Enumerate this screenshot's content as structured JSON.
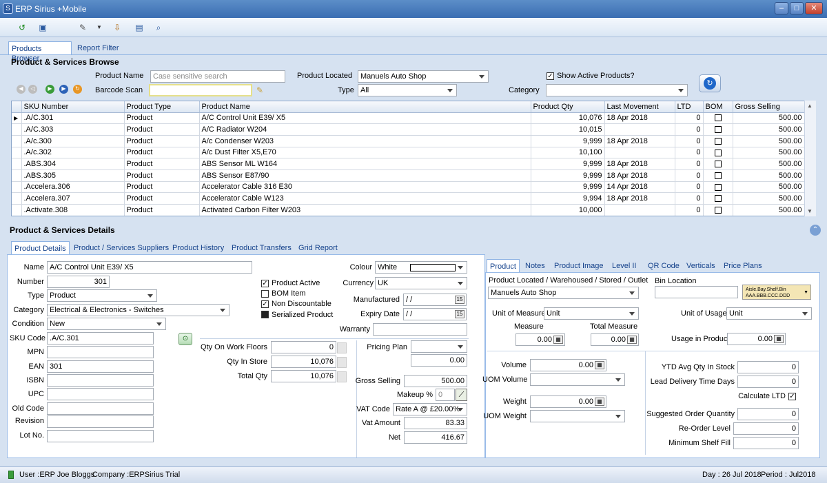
{
  "window": {
    "title": "ERP Sirius +Mobile",
    "icon": "app-icon"
  },
  "toolbar": {
    "icons": [
      "refresh-icon",
      "new-document-icon",
      "wrench-icon",
      "dropdown-icon",
      "export-icon",
      "save-icon",
      "search-icon"
    ]
  },
  "main_tabs": [
    "Products Browser",
    "Report Filter"
  ],
  "browse": {
    "title": "Product & Services Browse",
    "product_name_label": "Product Name",
    "product_name_placeholder": "Case sensitive search",
    "barcode_label": "Barcode Scan",
    "barcode_value": "",
    "located_label": "Product Located",
    "located_value": "Manuels Auto Shop",
    "type_label": "Type",
    "type_value": "All",
    "category_label": "Category",
    "category_value": "",
    "active_label": "Show Active Products?",
    "active_checked": true
  },
  "grid": {
    "columns": [
      "SKU Number",
      "Product Type",
      "Product Name",
      "Product Qty",
      "Last Movement",
      "LTD",
      "BOM",
      "Gross Selling"
    ],
    "rows": [
      [
        ".A/C.301",
        "Product",
        "A/C Control Unit E39/ X5",
        "10,076",
        "18 Apr 2018",
        "0",
        "",
        "500.00"
      ],
      [
        ".A/C.303",
        "Product",
        "A/C Radiator W204",
        "10,015",
        "",
        "0",
        "",
        "500.00"
      ],
      [
        ".A/c.300",
        "Product",
        "A/c Condenser W203",
        "9,999",
        "18 Apr 2018",
        "0",
        "",
        "500.00"
      ],
      [
        ".A/c.302",
        "Product",
        "A/c Dust Filter X5,E70",
        "10,100",
        "",
        "0",
        "",
        "500.00"
      ],
      [
        ".ABS.304",
        "Product",
        "ABS Sensor  ML W164",
        "9,999",
        "18 Apr 2018",
        "0",
        "",
        "500.00"
      ],
      [
        ".ABS.305",
        "Product",
        "ABS Sensor E87/90",
        "9,999",
        "18 Apr 2018",
        "0",
        "",
        "500.00"
      ],
      [
        ".Accelera.306",
        "Product",
        "Accelerator Cable 316 E30",
        "9,999",
        "14 Apr 2018",
        "0",
        "",
        "500.00"
      ],
      [
        ".Accelera.307",
        "Product",
        "Accelerator Cable W123",
        "9,994",
        "18 Apr 2018",
        "0",
        "",
        "500.00"
      ],
      [
        ".Activate.308",
        "Product",
        "Activated Carbon Filter W203",
        "10,000",
        "",
        "0",
        "",
        "500.00"
      ]
    ]
  },
  "details": {
    "title": "Product & Services Details",
    "tabs": [
      "Product Details",
      "Product / Services Suppliers",
      "Product History",
      "Product Transfers",
      "Grid Report"
    ],
    "name_label": "Name",
    "name_value": "A/C Control Unit E39/ X5",
    "number_label": "Number",
    "number_value": "301",
    "type_label": "Type",
    "type_value": "Product",
    "category_label": "Category",
    "category_value": "Electrical & Electronics - Switches",
    "condition_label": "Condition",
    "condition_value": "New",
    "sku_label": "SKU Code",
    "sku_value": ".A/C.301",
    "mpn_label": "MPN",
    "mpn_value": "",
    "ean_label": "EAN",
    "ean_value": "301",
    "isbn_label": "ISBN",
    "upc_label": "UPC",
    "oldcode_label": "Old Code",
    "revision_label": "Revision",
    "lotno_label": "Lot No.",
    "product_active": "Product Active",
    "bom_item": "BOM Item",
    "non_discountable": "Non Discountable",
    "serialized": "Serialized Product",
    "colour_label": "Colour",
    "colour_value": "White",
    "currency_label": "Currency",
    "currency_value": "UK",
    "manufactured_label": "Manufactured",
    "manufactured_value": "/ /",
    "expiry_label": "Expiry Date",
    "expiry_value": "/ /",
    "warranty_label": "Warranty",
    "warranty_value": "",
    "qty_floor_label": "Qty On Work Floors",
    "qty_floor_value": "0",
    "qty_store_label": "Qty In Store",
    "qty_store_value": "10,076",
    "total_qty_label": "Total Qty",
    "total_qty_value": "10,076",
    "pricing_plan_label": "Pricing Plan",
    "pricing_plan_value": "",
    "pricing_amount": "0.00",
    "gross_label": "Gross Selling",
    "gross_value": "500.00",
    "makeup_label": "Makeup %",
    "makeup_value": "0",
    "vat_code_label": "VAT Code",
    "vat_code_value": "Rate A @ £20.00%",
    "vat_amount_label": "Vat Amount",
    "vat_amount_value": "83.33",
    "net_label": "Net",
    "net_value": "416.67"
  },
  "right": {
    "tabs": [
      "Product",
      "Notes",
      "Product Image",
      "Level II",
      "QR Code",
      "Verticals",
      "Price Plans"
    ],
    "located_label": "Product Located / Warehoused / Stored / Outlet",
    "located_value": "Manuels Auto Shop",
    "bin_label": "Bin Location",
    "bin_value": "",
    "bin_hint_1": "Aisle.Bay.Shelf.Bin",
    "bin_hint_2": "AAA.BBB.CCC.DDD",
    "uom_label": "Unit of Measure",
    "uom_value": "Unit",
    "uou_label": "Unit of Usage",
    "uou_value": "Unit",
    "measure_label": "Measure",
    "measure_value": "0.00",
    "total_measure_label": "Total Measure",
    "total_measure_value": "0.00",
    "usage_label": "Usage in Product",
    "usage_value": "0.00",
    "volume_label": "Volume",
    "volume_value": "0.00",
    "uom_volume_label": "UOM Volume",
    "uom_volume_value": "",
    "weight_label": "Weight",
    "weight_value": "0.00",
    "uom_weight_label": "UOM Weight",
    "uom_weight_value": "",
    "ytd_label": "YTD Avg Qty In Stock",
    "ytd_value": "0",
    "lead_label": "Lead Delivery Time Days",
    "lead_value": "0",
    "calc_ltd_label": "Calculate LTD",
    "suggested_label": "Suggested Order Quantity",
    "suggested_value": "0",
    "reorder_label": "Re-Order Level",
    "reorder_value": "0",
    "minshelf_label": "Minimum Shelf Fill",
    "minshelf_value": "0"
  },
  "status": {
    "user": "User :ERP Joe Bloggs",
    "company": "Company :ERPSirius Trial",
    "day": "Day : 26 Jul 2018",
    "period": "Period : Jul2018"
  }
}
